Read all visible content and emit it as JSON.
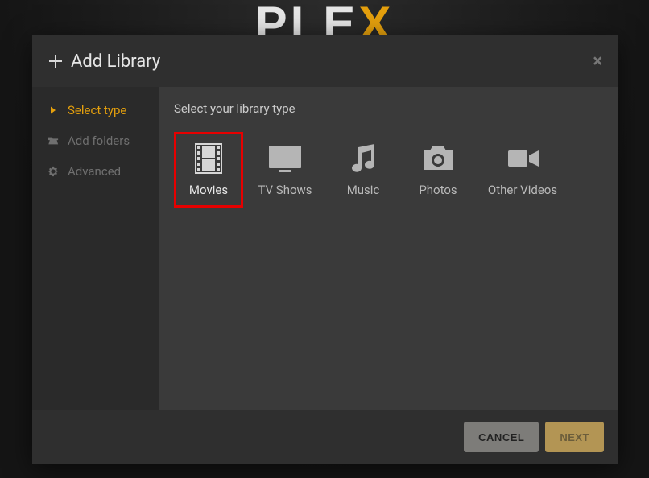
{
  "logo": {
    "text_pre": "PLE",
    "text_accent": "X"
  },
  "modal": {
    "title": "Add Library",
    "sidebar": {
      "items": [
        {
          "label": "Select type",
          "active": true
        },
        {
          "label": "Add folders",
          "active": false
        },
        {
          "label": "Advanced",
          "active": false
        }
      ]
    },
    "content": {
      "heading": "Select your library type",
      "types": [
        {
          "label": "Movies"
        },
        {
          "label": "TV Shows"
        },
        {
          "label": "Music"
        },
        {
          "label": "Photos"
        },
        {
          "label": "Other Videos"
        }
      ],
      "selected_index": 0
    },
    "footer": {
      "cancel": "CANCEL",
      "next": "NEXT"
    }
  }
}
